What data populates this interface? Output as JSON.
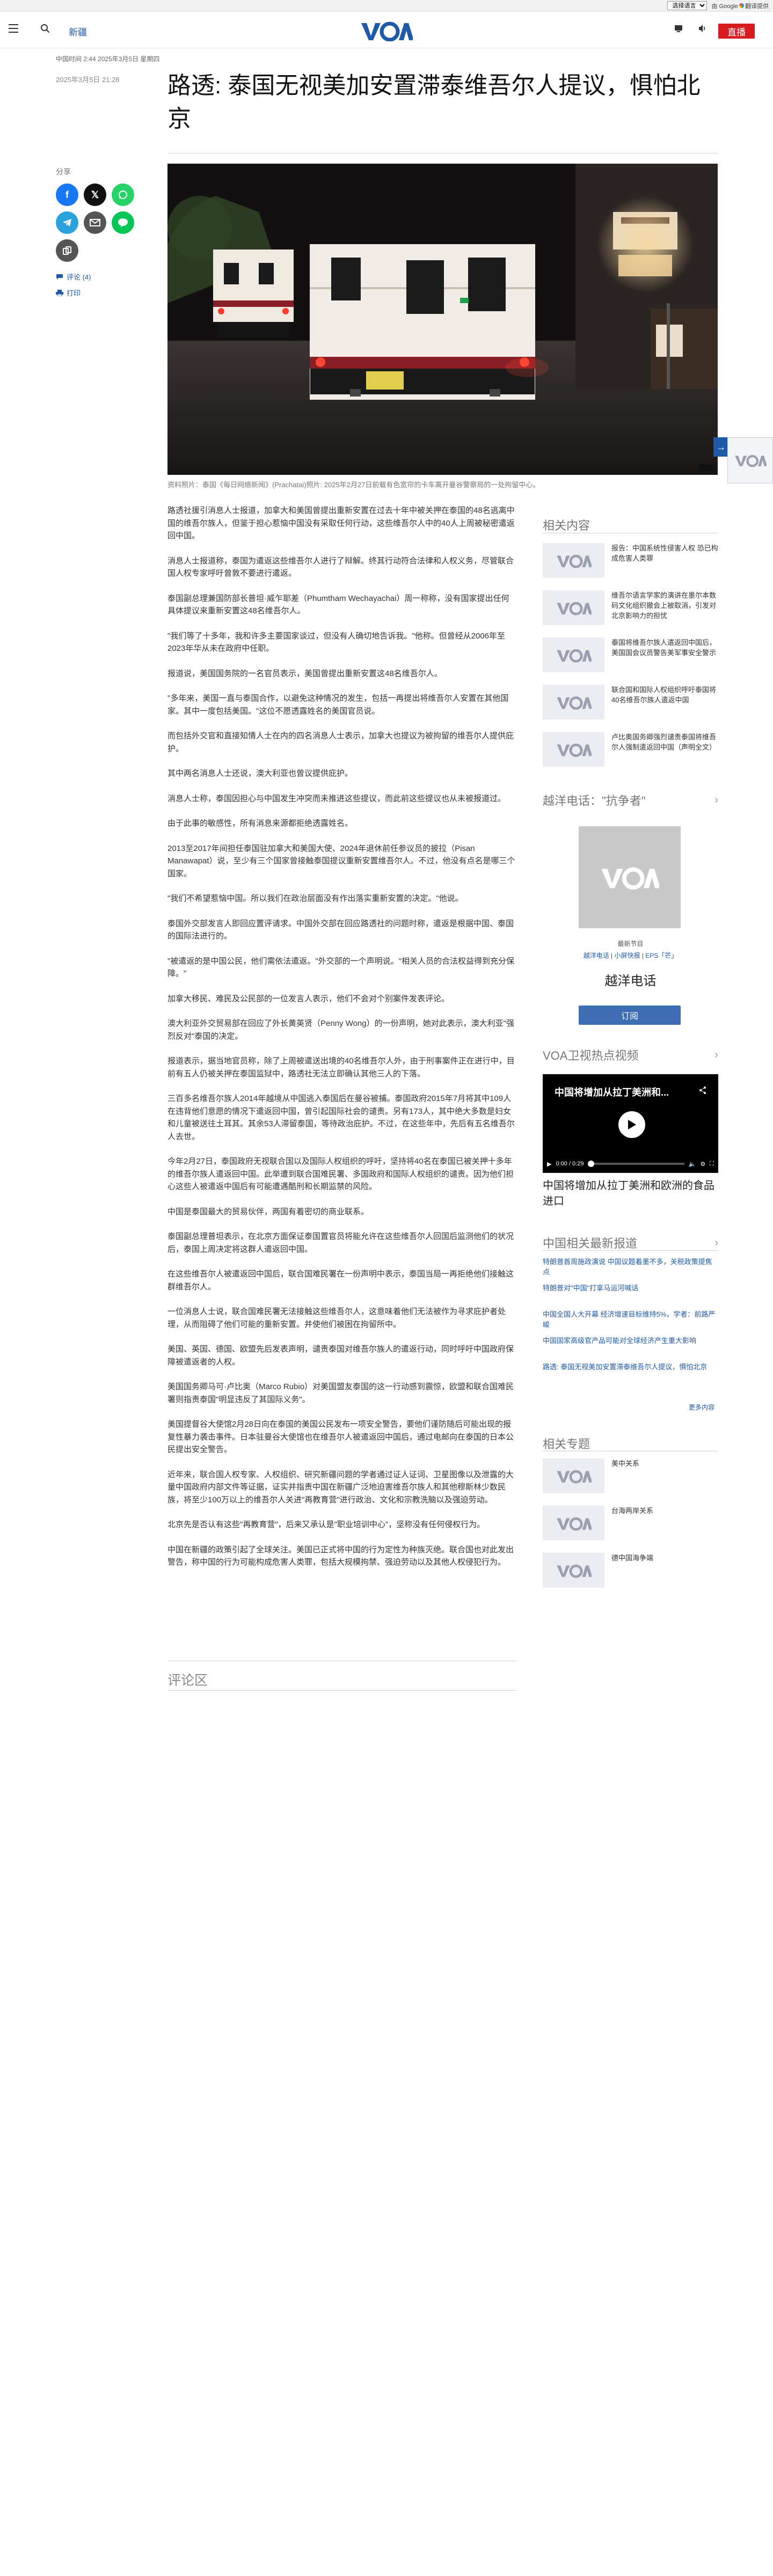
{
  "topbar": {
    "language_select": "选择语言",
    "google_label": "由 Google",
    "translate_label": "翻译提供"
  },
  "header": {
    "nav_news": "新疆",
    "logo_text": "VOA",
    "live_label": "直播"
  },
  "article": {
    "kicker": "中国时间 2:44 2025年3月5日 星期四",
    "pubdate": "2025年3月5日 21:28",
    "headline": "路透: 泰国无视美加安置滞泰维吾尔人提议，惧怕北京",
    "share_label": "分享",
    "comments_link": "评论 (4)",
    "print_link": "打印",
    "image_caption": "资料照片：泰国《每日网络新闻》(Prachatai)照片: 2025年2月27日前载有色宽帘的卡车离开曼谷警察局的一处拘留中心。",
    "paragraphs": [
      "路透社援引消息人士报道，加拿大和美国曾提出重新安置在过去十年中被关押在泰国的48名逃离中国的维吾尔族人，但鉴于担心惹恼中国没有采取任何行动，这些维吾尔人中的40人上周被秘密遣返回中国。",
      "消息人士报道称，泰国为遣返这些维吾尔人进行了辩解。终其行动符合法律和人权义务，尽管联合国人权专家呼吁曾敦不要进行遣返。",
      "泰国副总理兼国防部长普坦·威乍耶差（Phumtham Wechayachai）周一称称，没有国家提出任何具体提议来重新安置这48名维吾尔人。",
      "\"我们等了十多年，我和许多主要国家谈过，但没有人确切地告诉我。\"他称。但曾经从2006年至2023年华从未在政府中任职。",
      "报道说，美国国务院的一名官员表示，美国曾提出重新安置这48名维吾尔人。",
      "\"多年来，美国一直与泰国合作，以避免这种情况的发生，包括一再提出将维吾尔人安置在其他国家。其中一度包括美国。\"这位不愿透露姓名的美国官员说。",
      "而包括外交官和直接知情人士在内的四名消息人士表示，加拿大也提议为被拘留的维吾尔人提供庇护。",
      "其中两名消息人士还说，澳大利亚也曾议提供庇护。",
      "消息人士称，泰国因担心与中国发生冲突而未推进这些提议，而此前这些提议也从未被报道过。",
      "由于此事的敏感性，所有消息来源都拒绝透露姓名。",
      "2013至2017年间担任泰国驻加拿大和美国大使、2024年退休前任参议员的披拉（Pisan Manawapat）说，至少有三个国家曾接触泰国提议重新安置维吾尔人。不过，他没有点名是哪三个国家。",
      "\"我们不希望惹恼中国。所以我们在政治层面没有作出落实重新安置的决定。\"他说。",
      "泰国外交部发言人即回应置评请求。中国外交部在回应路透社的问题时称，遣返是根据中国、泰国的国际法进行的。",
      "\"被遣返的是中国公民，他们需依法遣返。\"外交部的一个声明说。\"相关人员的合法权益得到充分保障。\"",
      "加拿大移民、难民及公民部的一位发言人表示，他们不会对个别案件发表评论。",
      "澳大利亚外交贸易部在回应了外长黄英贤（Penny Wong）的一份声明，她对此表示，澳大利亚\"强烈反对\"泰国的决定。",
      "报道表示，据当地官员称，除了上周被遣送出境的40名维吾尔人外，由于刑事案件正在进行中，目前有五人仍被关押在泰国监狱中，路透社无法立即确认其他三人的下落。",
      "三百多名维吾尔族人2014年越境从中国逃入泰国后在曼谷被捕。泰国政府2015年7月将其中109人在违背他们意愿的情况下遣返回中国，曾引起国际社会的谴责。另有173人，其中绝大多数是妇女和儿童被送往土耳其。其余53人滞留泰国，等待政治庇护。不过，在这些年中，先后有五名维吾尔人去世。",
      "今年2月27日，泰国政府无视联合国以及国际人权组织的呼吁，坚持将40名在泰国已被关押十多年的维吾尔族人遣返回中国。此举遭到联合国难民署、多国政府和国际人权组织的谴责。因为他们担心这些人被遣返中国后有可能遭遇酷刑和长期监禁的风险。",
      "中国是泰国最大的贸易伙伴，两国有着密切的商业联系。",
      "泰国副总理普坦表示，在北京方面保证泰国置官员将能允许在这些维吾尔人回国后监测他们的状况后，泰国上周决定将这群人遣返回中国。",
      "在这些维吾尔人被遣返回中国后，联合国难民署在一份声明中表示，泰国当局一再拒绝他们接触这群维吾尔人。",
      "一位消息人士说，联合国难民署无法接触这些维吾尔人，这意味着他们无法被作为寻求庇护者处理，从而阻碍了他们可能的重新安置。并使他们被困在拘留所中。",
      "美国、英国、德国、欧盟先后发表声明，谴责泰国对维吾尔族人的遣返行动，同时呼吁中国政府保障被遣返者的人权。",
      "美国国务卿马可·卢比奥（Marco Rubio）对美国盟友泰国的这一行动感到震惊，欧盟和联合国难民署则指责泰国\"明显违反了其国际义务\"。",
      "美国提督谷大使馆2月28日向在泰国的美国公民发布一项安全警告，要他们谨防随后可能出现的报复性暴力袭击事件。日本驻曼谷大使馆也在维吾尔人被遣返回中国后，通过电邮向在泰国的日本公民提出安全警告。",
      "近年来，联合国人权专家、人权组织、研究新疆问题的学者通过证人证词、卫星图像以及泄露的大量中国政府内部文件等证据，证实并指责中国在新疆广泛地迫害维吾尔族人和其他穆斯林少数民族，将至少100万以上的维吾尔人关进\"再教育营\"进行政治、文化和宗教洗脑以及强迫劳动。",
      "北京先是否认有这些\"再教育营\"，后来又承认是\"职业培训中心\"，坚称没有任何侵权行为。",
      "中国在新疆的政策引起了全球关注。美国已正式将中国的行为定性为种族灭绝。联合国也对此发出警告，称中国的行为可能构成危害人类罪，包括大规模拘禁、强迫劳动以及其他人权侵犯行为。"
    ],
    "comments_title": "评论区"
  },
  "sidebar": {
    "related_title": "相关内容",
    "related": [
      "报告：中国系统性侵害人权 恐已构成危害人类罪",
      "维吾尔语言学家的演讲在墨尔本数码文化组织撤会上被取消，引发对北京影响力的担忧",
      "泰国将维吾尔族人遣返回中国后，美国国会议员警告美军事安全警示",
      "联合国和国际人权组织呼吁泰国将40名维吾尔族人遣返中国",
      "卢比奥国务卿强烈谴责泰国将维吾尔人强制遣返回中国（声明全文）"
    ],
    "podcast_title": "越洋电话：\"抗争者\"",
    "podcast_caption": "最新节目",
    "podcast_links": "越洋电话 | 小屏快报 | EPS「芒」",
    "podcast_name": "越洋电话",
    "subscribe_label": "订阅",
    "video_section_title": "VOA卫视热点视频",
    "video_overlay_title": "中国将增加从拉丁美洲和...",
    "video_time": "0:00 / 0:29",
    "video_title": "中国将增加从拉丁美洲和欧洲的食品进口",
    "china_news_title": "中国相关最新报道",
    "china_news": [
      "特朗普首周施政演说 中国议题着墨不多，关税政策提焦点",
      "特朗普对\"中国\"打拿马运河喊话",
      "中国全国人大开幕 经济增速目标维持5%，学者：前路严峻",
      "中国国家高级官产品可能对全球经济产生重大影响",
      "路透: 泰国无视美加安置滞泰维吾尔人提议，惧怕北京"
    ],
    "more_label": "更多内容",
    "topics_title": "相关专题",
    "topics": [
      "美中关系",
      "台海两岸关系",
      "德中国海争端"
    ]
  }
}
